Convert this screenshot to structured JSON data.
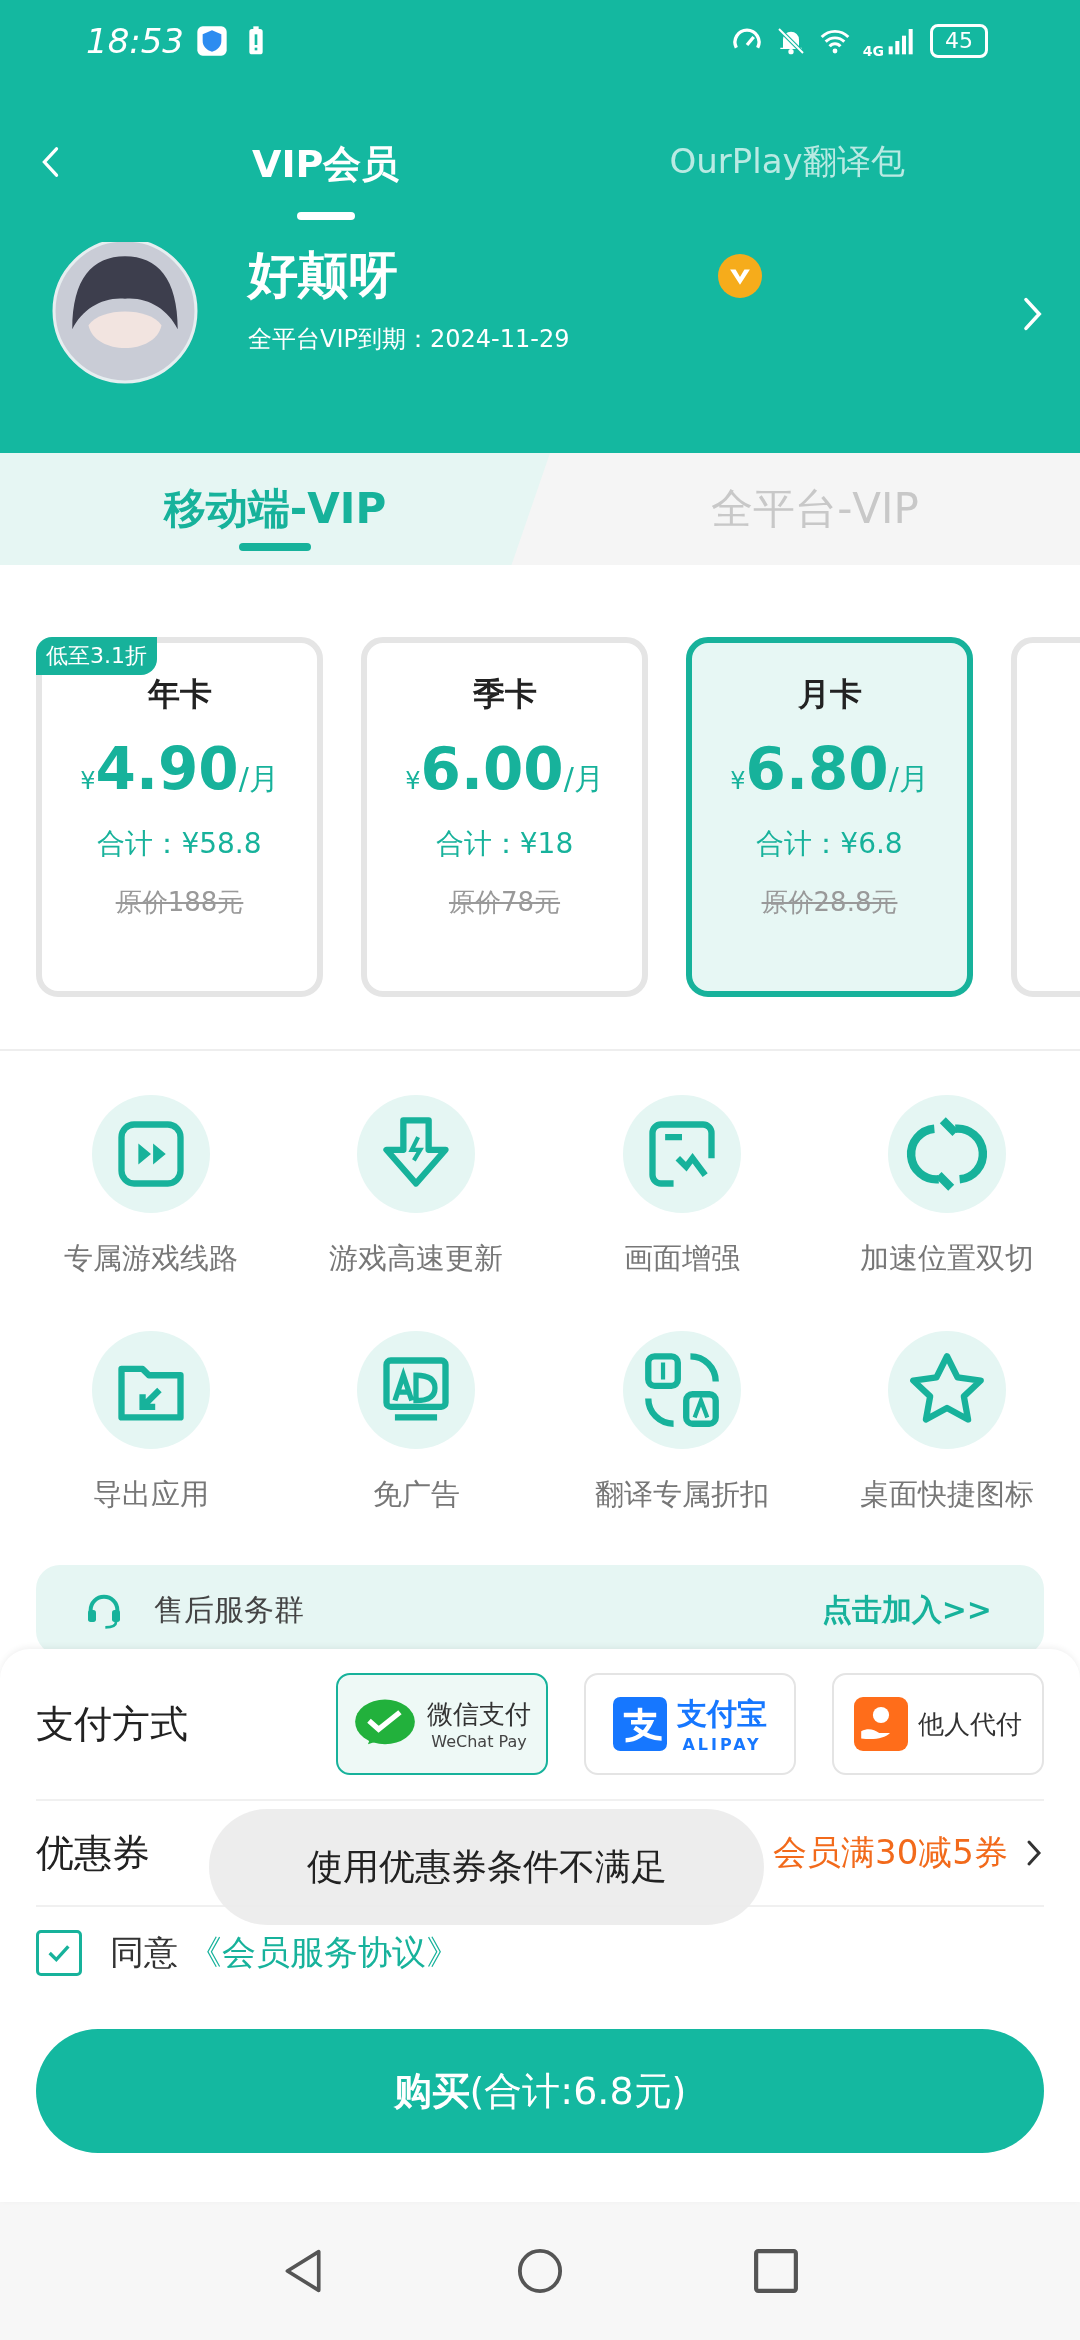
{
  "status_bar": {
    "time": "18:53",
    "network": "4G",
    "battery": "45"
  },
  "header": {
    "tabs": [
      {
        "label": "VIP会员",
        "selected": true
      },
      {
        "label": "OurPlay翻译包",
        "selected": false
      }
    ]
  },
  "profile": {
    "name": "好颠呀",
    "expiry": "全平台VIP到期：2024-11-29"
  },
  "platform_tabs": [
    {
      "label": "移动端-VIP",
      "selected": true
    },
    {
      "label": "全平台-VIP",
      "selected": false
    }
  ],
  "plans": [
    {
      "badge": "低至3.1折",
      "title": "年卡",
      "currency": "¥",
      "price": "4.90",
      "unit": "/月",
      "total": "合计：¥58.8",
      "original": "原价188元",
      "selected": false
    },
    {
      "title": "季卡",
      "currency": "¥",
      "price": "6.00",
      "unit": "/月",
      "total": "合计：¥18",
      "original": "原价78元",
      "selected": false
    },
    {
      "title": "月卡",
      "currency": "¥",
      "price": "6.80",
      "unit": "/月",
      "total": "合计：¥6.8",
      "original": "原价28.8元",
      "selected": true
    }
  ],
  "features": [
    {
      "kind": "play",
      "label": "专属游戏线路"
    },
    {
      "kind": "download",
      "label": "游戏高速更新"
    },
    {
      "kind": "screen",
      "label": "画面增强"
    },
    {
      "kind": "swap",
      "label": "加速位置双切"
    },
    {
      "kind": "export",
      "label": "导出应用"
    },
    {
      "kind": "ad",
      "label": "免广告"
    },
    {
      "kind": "translate",
      "label": "翻译专属折扣"
    },
    {
      "kind": "star",
      "label": "桌面快捷图标"
    }
  ],
  "service": {
    "label": "售后服务群",
    "action": "点击加入>>"
  },
  "payment": {
    "label": "支付方式",
    "methods": [
      {
        "kind": "wechat",
        "label": "微信支付",
        "sublabel": "WeChat Pay",
        "selected": true
      },
      {
        "kind": "alipay",
        "label": "支付宝",
        "sublabel": "ALIPAY",
        "selected": false
      },
      {
        "kind": "proxy",
        "label": "他人代付",
        "selected": false
      }
    ]
  },
  "coupon": {
    "label": "优惠券",
    "value": "会员满30减5券"
  },
  "agreement": {
    "checked": true,
    "text": "同意",
    "link": "《会员服务协议》"
  },
  "toast": {
    "text": "使用优惠券条件不满足"
  },
  "buy_button": {
    "label": "**购买**(合计:6.8元)"
  }
}
